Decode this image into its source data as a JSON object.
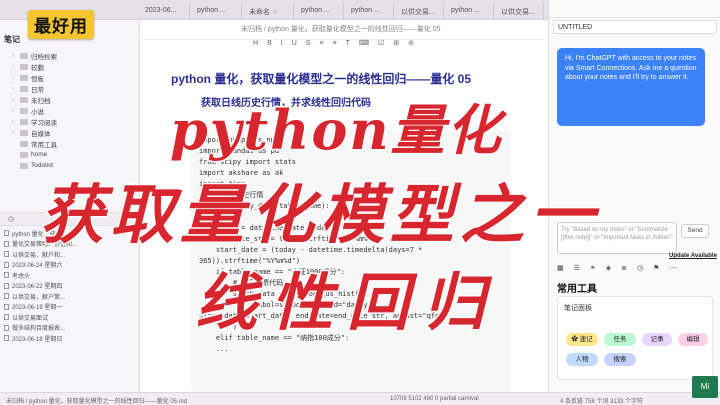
{
  "badge": "最好用",
  "tabs": [
    "2023-06...",
    "python ...",
    "未命名",
    "python ...",
    "python ...",
    "以供交易...",
    "python ...",
    "以供交易..."
  ],
  "breadcrumb": "未归档 / python 量化，获取量化模型之一的线性回归——量化 05",
  "toolbar_icons": [
    "H",
    "B",
    "I",
    "U",
    "S",
    "≡",
    "≡",
    "T",
    "⌨",
    "☑",
    "⊞",
    "⊘"
  ],
  "sidebar": {
    "header": "笔记",
    "tree": [
      {
        "label": "归档检索",
        "arrow": "›"
      },
      {
        "label": "较鹏",
        "arrow": "›"
      },
      {
        "label": "恒板",
        "arrow": "›"
      },
      {
        "label": "日常",
        "arrow": "›"
      },
      {
        "label": "未归档",
        "arrow": "›"
      },
      {
        "label": "小说",
        "arrow": "›"
      },
      {
        "label": "学习阅读",
        "arrow": "›"
      },
      {
        "label": "自媒体",
        "arrow": "›"
      },
      {
        "label": "常用工具",
        "arrow": ""
      },
      {
        "label": "home",
        "arrow": ""
      },
      {
        "label": "Todolist",
        "arrow": ""
      }
    ],
    "recent": [
      "python 量化，获取...",
      "量化交易策略、价值和...",
      "以供交易、献户和...",
      "2023-06-24 星期六",
      "考虑头",
      "2023-06-22 星期四",
      "以供交易，献户策...",
      "2023-06-19 星期一",
      "以供交易面试",
      "做多结构百度报表...",
      "2023-06-18 星期日"
    ]
  },
  "editor": {
    "title": "python 量化，获取量化模型之一的线性回归——量化 05",
    "subtitle": "获取日线历史行情，并求线性回归代码",
    "code": [
      "import numpy as np",
      "import pandas as pd",
      "from scipy import stats",
      "import akshare as ak",
      "import time",
      "# 获取日线历史行情",
      "def get_daily_data(table_name):",
      "",
      "    today = datetime.date.today()",
      "    end_date_str = today.strftime(\"%Y%m%d\")",
      "    start_date = (today - datetime.timedelta(days=7 *",
      "365)).strftime(\"%Y%m%d\")",
      "    if table_name == \"中证1000成分\":",
      "        # 遍历股票代码",
      "        stock_data = ak.stock_us_hist(",
      "            symbol=symbol, period=\"daily\",",
      "start_date=start_date, end_date=end_date_str, adjust=\"qfq\"",
      "        )",
      "    elif table_name == \"纳指100成分\":",
      "    ..."
    ]
  },
  "right_panel": {
    "title": "UNTITLED",
    "chat_message": "Hi, I'm ChatGPT with access to your notes via Smart Connections. Ask me a question about your notes and I'll try to answer it.",
    "input_placeholder": "Try \"Based on my notes\" or \"Summarize [[this note]]\" or \"Important tasks in /folder/\"",
    "send_label": "Send",
    "update_link": "Update Available",
    "tools_title": "常用工具",
    "note_panel_title": "笔记面板",
    "pills": [
      {
        "label": "✿ 速记",
        "color": "#fde68a"
      },
      {
        "label": "任务",
        "color": "#bbf7d0"
      },
      {
        "label": "记事",
        "color": "#e9d5ff"
      },
      {
        "label": "编辑",
        "color": "#fbcfe8"
      },
      {
        "label": "人物",
        "color": "#bfdbfe"
      },
      {
        "label": "搜索",
        "color": "#c7d2fe"
      }
    ]
  },
  "status_bar": {
    "left": "未归档 / python 量化，获取量化模型之一的线性回归——量化 05.md",
    "mid": "10709  5102  480  0  partial  carnival",
    "right": "4 条反链  758 个词  3133 个字符"
  },
  "overlay": {
    "line1": "python量化",
    "line2": "获取量化模型之一",
    "line3": "线性回归"
  },
  "corner_logo": "Mi"
}
